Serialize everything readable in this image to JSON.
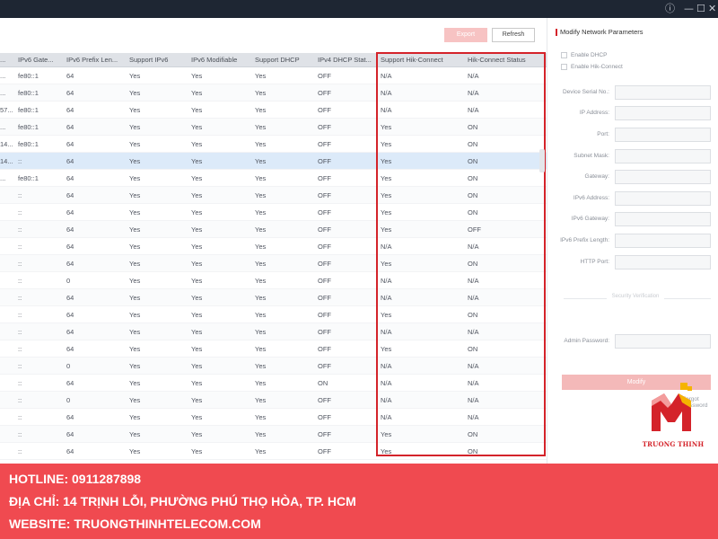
{
  "toolbar": {
    "export_label": "Export",
    "refresh_label": "Refresh"
  },
  "window": {
    "info_glyph": "ⓘ",
    "minimize_glyph": "—",
    "maximize_glyph": "☐",
    "close_glyph": "✕"
  },
  "table": {
    "headers": [
      "...",
      "IPv6 Gate...",
      "IPv6 Prefix Len...",
      "Support IPv6",
      "IPv6 Modifiable",
      "Support DHCP",
      "IPv4 DHCP Stat...",
      "Support Hik-Connect",
      "Hik-Connect Status"
    ],
    "rows": [
      [
        "...",
        "fe80::1",
        "64",
        "Yes",
        "Yes",
        "Yes",
        "OFF",
        "N/A",
        "N/A"
      ],
      [
        "...",
        "fe80::1",
        "64",
        "Yes",
        "Yes",
        "Yes",
        "OFF",
        "N/A",
        "N/A"
      ],
      [
        "57...",
        "fe80::1",
        "64",
        "Yes",
        "Yes",
        "Yes",
        "OFF",
        "N/A",
        "N/A"
      ],
      [
        "...",
        "fe80::1",
        "64",
        "Yes",
        "Yes",
        "Yes",
        "OFF",
        "Yes",
        "ON"
      ],
      [
        "14...",
        "fe80::1",
        "64",
        "Yes",
        "Yes",
        "Yes",
        "OFF",
        "Yes",
        "ON"
      ],
      [
        "14...",
        "::",
        "64",
        "Yes",
        "Yes",
        "Yes",
        "OFF",
        "Yes",
        "ON"
      ],
      [
        "...",
        "fe80::1",
        "64",
        "Yes",
        "Yes",
        "Yes",
        "OFF",
        "Yes",
        "ON"
      ],
      [
        "",
        "::",
        "64",
        "Yes",
        "Yes",
        "Yes",
        "OFF",
        "Yes",
        "ON"
      ],
      [
        "",
        "::",
        "64",
        "Yes",
        "Yes",
        "Yes",
        "OFF",
        "Yes",
        "ON"
      ],
      [
        "",
        "::",
        "64",
        "Yes",
        "Yes",
        "Yes",
        "OFF",
        "Yes",
        "OFF"
      ],
      [
        "",
        "::",
        "64",
        "Yes",
        "Yes",
        "Yes",
        "OFF",
        "N/A",
        "N/A"
      ],
      [
        "",
        "::",
        "64",
        "Yes",
        "Yes",
        "Yes",
        "OFF",
        "Yes",
        "ON"
      ],
      [
        "",
        "::",
        "0",
        "Yes",
        "Yes",
        "Yes",
        "OFF",
        "N/A",
        "N/A"
      ],
      [
        "",
        "::",
        "64",
        "Yes",
        "Yes",
        "Yes",
        "OFF",
        "N/A",
        "N/A"
      ],
      [
        "",
        "::",
        "64",
        "Yes",
        "Yes",
        "Yes",
        "OFF",
        "Yes",
        "ON"
      ],
      [
        "",
        "::",
        "64",
        "Yes",
        "Yes",
        "Yes",
        "OFF",
        "N/A",
        "N/A"
      ],
      [
        "",
        "::",
        "64",
        "Yes",
        "Yes",
        "Yes",
        "OFF",
        "Yes",
        "ON"
      ],
      [
        "",
        "::",
        "0",
        "Yes",
        "Yes",
        "Yes",
        "OFF",
        "N/A",
        "N/A"
      ],
      [
        "",
        "::",
        "64",
        "Yes",
        "Yes",
        "Yes",
        "ON",
        "N/A",
        "N/A"
      ],
      [
        "",
        "::",
        "0",
        "Yes",
        "Yes",
        "Yes",
        "OFF",
        "N/A",
        "N/A"
      ],
      [
        "",
        "::",
        "64",
        "Yes",
        "Yes",
        "Yes",
        "OFF",
        "N/A",
        "N/A"
      ],
      [
        "",
        "::",
        "64",
        "Yes",
        "Yes",
        "Yes",
        "OFF",
        "Yes",
        "ON"
      ],
      [
        "",
        "::",
        "64",
        "Yes",
        "Yes",
        "Yes",
        "OFF",
        "Yes",
        "ON"
      ]
    ],
    "selected_row": 5
  },
  "panel": {
    "title": "Modify Network Parameters",
    "enable_dhcp": "Enable DHCP",
    "enable_hik": "Enable Hik-Connect",
    "fields": [
      "Device Serial No.:",
      "IP Address:",
      "Port:",
      "Subnet Mask:",
      "Gateway:",
      "IPv6 Address:",
      "IPv6 Gateway:",
      "IPv6 Prefix Length:",
      "HTTP Port:"
    ],
    "security_label": "Security Verification",
    "admin_password": "Admin Password:",
    "modify_label": "Modify",
    "forgot_label": "Forgot Password"
  },
  "logo": {
    "text": "TRUONG THINH"
  },
  "banner": {
    "hotline": "HOTLINE: 0911287898",
    "address": "ĐỊA CHỈ: 14 TRỊNH LỖI, PHƯỜNG PHÚ THỌ HÒA, TP. HCM",
    "website": "WEBSITE: TRUONGTHINHTELECOM.COM"
  },
  "colors": {
    "accent": "#d4232a",
    "banner": "#f04a50",
    "selected": "#dceaf9",
    "titlebar": "#1e2633"
  }
}
